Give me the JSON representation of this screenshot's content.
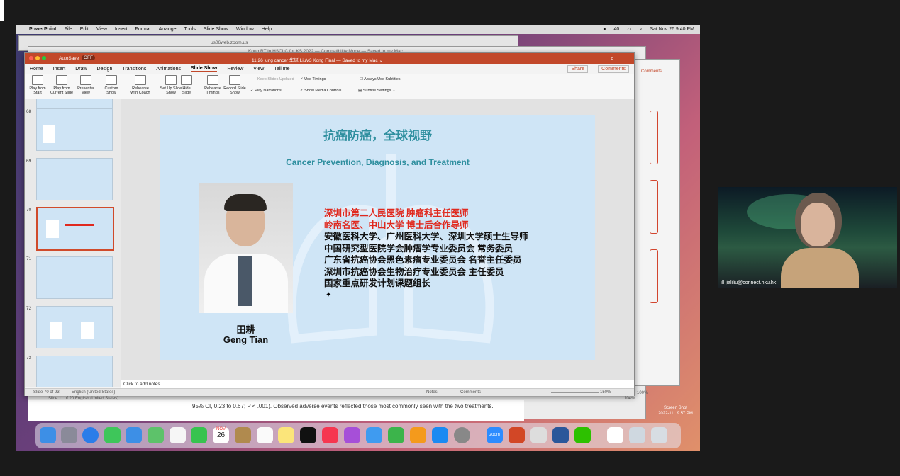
{
  "menubar": {
    "app": "PowerPoint",
    "items": [
      "File",
      "Edit",
      "View",
      "Insert",
      "Format",
      "Arrange",
      "Tools",
      "Slide Show",
      "Window",
      "Help"
    ],
    "battery": "40",
    "datetime": "Sat Nov 26  9:40 PM"
  },
  "bg_window": {
    "url": "us06web.zoom.us",
    "title": "Kong RT in HSCLC for KS 2022 — Compatibility Mode — Saved to my Mac",
    "status": "Slide 11 of 20   English (United States)",
    "zoom": "104%",
    "partial_text": "95% CI, 0.23 to 0.67; P < .001). Observed adverse events reflected those most commonly seen with the two treatments."
  },
  "ppt": {
    "autosave": "AutoSave",
    "autosave_state": "OFF",
    "title": "11.26 lung cancer 华诞 LiuV3 Kong Final — Saved to my Mac ⌄",
    "tabs": [
      "Home",
      "Insert",
      "Draw",
      "Design",
      "Transitions",
      "Animations",
      "Slide Show",
      "Review",
      "View",
      "Tell me"
    ],
    "active_tab": "Slide Show",
    "share": "Share",
    "comments": "Comments",
    "ribbon": {
      "play_from_start": "Play from Start",
      "play_from_current": "Play from Current Slide",
      "presenter_view": "Presenter View",
      "custom_show": "Custom Show",
      "rehearse_coach": "Rehearse with Coach",
      "set_up": "Set Up Slide Show",
      "hide_slide": "Hide Slide",
      "rehearse_timings": "Rehearse Timings",
      "record": "Record Slide Show",
      "keep_updated": "Keep Slides Updated",
      "use_timings": "Use Timings",
      "play_narrations": "Play Narrations",
      "show_media": "Show Media Controls",
      "always_subtitles": "Always Use Subtitles",
      "subtitle_settings": "Subtitle Settings"
    },
    "thumb_numbers": [
      "68",
      "69",
      "70",
      "71",
      "72",
      "73"
    ],
    "notes_placeholder": "Click to add notes",
    "status_left": "Slide 70 of 93",
    "status_lang": "English (United States)",
    "status_notes": "Notes",
    "status_comments": "Comments",
    "zoom": "150%"
  },
  "slide": {
    "title_cn": "抗癌防癌，全球视野",
    "subtitle_en": "Cancer Prevention, Diagnosis, and Treatment",
    "red_lines": [
      "深圳市第二人民医院  肿瘤科主任医师",
      "岭南名医、中山大学 博士后合作导师"
    ],
    "black_lines": [
      "安徽医科大学、广州医科大学、深圳大学硕士生导师",
      "中国研究型医院学会肿瘤学专业委员会     常务委员",
      "广东省抗癌协会黑色素瘤专业委员会      名誉主任委员",
      "深圳市抗癌协会生物治疗专业委员会      主任委员",
      "国家重点研发计划课题组长"
    ],
    "name_cn": "田耕",
    "name_en": "Geng Tian"
  },
  "side_window": {
    "comments": "Comments",
    "zoom": "100%"
  },
  "screenshot_label": "Screen Shot\n2022-11...9.57 PM",
  "webcam": {
    "user": "jialiliu@connect.hku.hk"
  },
  "dock": {
    "calendar_month": "NOV",
    "calendar_day": "26",
    "zoom_label": "zoom"
  },
  "colors": {
    "ppt_accent": "#c2482a",
    "slide_teal": "#2f8f9f",
    "red_text": "#e0291e"
  }
}
